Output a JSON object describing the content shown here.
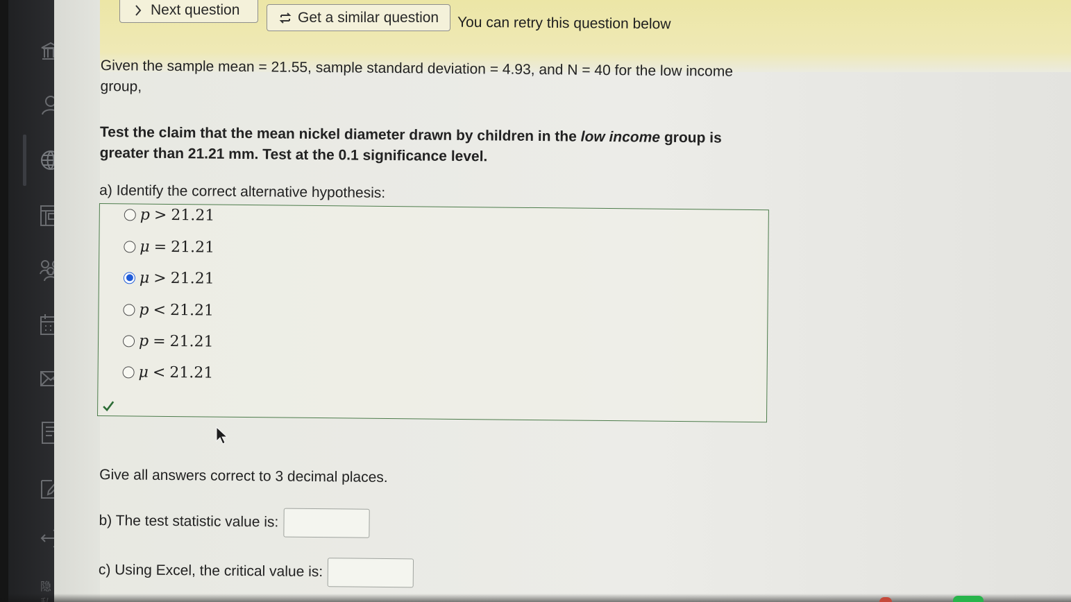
{
  "toolbar": {
    "next_label": "Next question",
    "similar_label": "Get a similar question",
    "retry_message": "You can retry this question below"
  },
  "problem": {
    "given": "Given the sample mean = 21.55, sample standard deviation = 4.93, and N = 40 for the low income group,",
    "claim_prefix": "Test the claim that the mean nickel diameter drawn by children in the ",
    "claim_emphasis": "low income",
    "claim_suffix": " group is greater than 21.21 mm. Test at the 0.1 significance level.",
    "part_a": "a) Identify the correct alternative hypothesis:",
    "options": [
      {
        "variable": "p",
        "operator": ">",
        "value": "21.21",
        "selected": false
      },
      {
        "variable": "μ",
        "operator": "=",
        "value": "21.21",
        "selected": false
      },
      {
        "variable": "μ",
        "operator": ">",
        "value": "21.21",
        "selected": true
      },
      {
        "variable": "p",
        "operator": "<",
        "value": "21.21",
        "selected": false
      },
      {
        "variable": "p",
        "operator": "=",
        "value": "21.21",
        "selected": false
      },
      {
        "variable": "μ",
        "operator": "<",
        "value": "21.21",
        "selected": false
      }
    ],
    "instructions": "Give all answers correct to 3 decimal places.",
    "part_b": "b) The test statistic value is:",
    "part_c": "c) Using Excel, the critical value is:",
    "part_b_value": "",
    "part_c_value": ""
  },
  "sidebar": {
    "privacy_text": "隐私"
  },
  "icons": {
    "sidebar": [
      "bank-icon",
      "user-icon",
      "globe-icon",
      "dashboard-icon",
      "groups-icon",
      "calendar-icon",
      "mail-icon",
      "document-icon",
      "edit-icon",
      "logout-icon"
    ],
    "toolbar": [
      "chevron-right-icon",
      "swap-icon"
    ],
    "status": [
      "checkmark-icon",
      "mouse-cursor-icon"
    ]
  },
  "colors": {
    "banner": "#efe9b6",
    "selected_radio": "#1f5bd8",
    "correct_border": "#4b7b4a"
  }
}
